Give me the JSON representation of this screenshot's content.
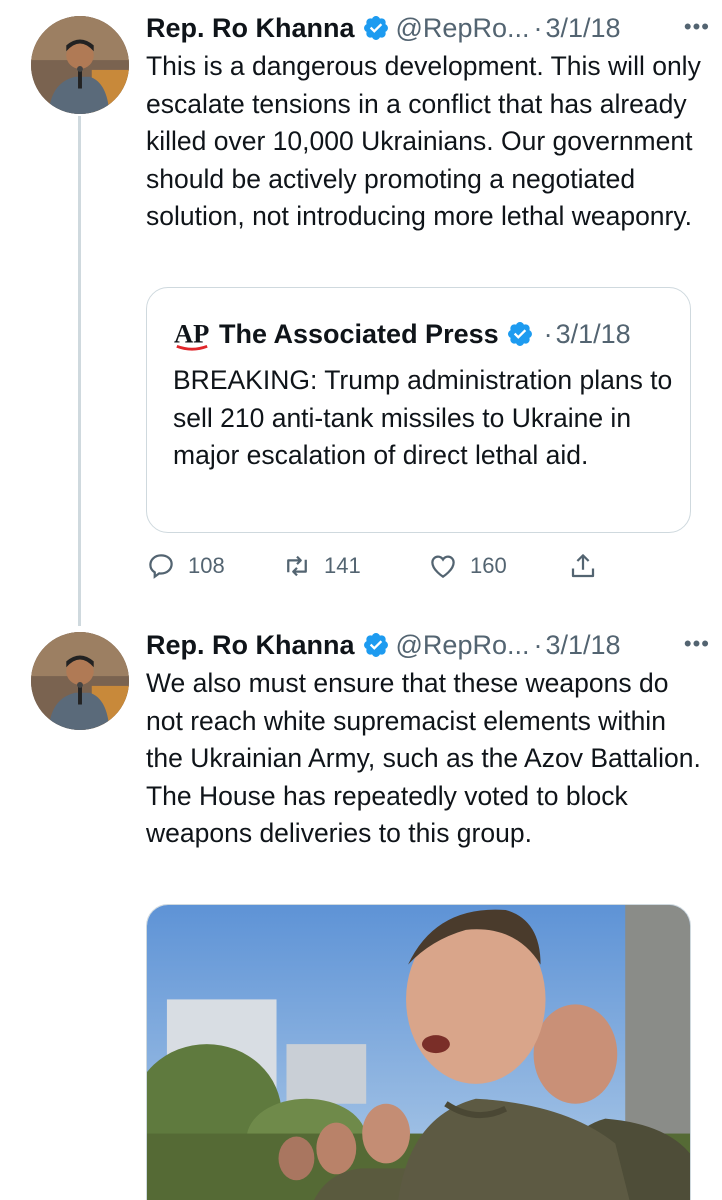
{
  "tweets": [
    {
      "name": "Rep. Ro Khanna",
      "handle": "@RepRo...",
      "dot": "·",
      "date": "3/1/18",
      "more": "•••",
      "text": "This is a dangerous development. This will only escalate tensions in a conflict that has already killed over 10,000 Ukrainians. Our government should be actively promoting a negotiated solution, not introducing more lethal weaponry.",
      "quote": {
        "logo_text": "AP",
        "name": "The Associated Press",
        "dot": "·",
        "date": "3/1/18",
        "text": "BREAKING: Trump administration plans to sell 210 anti-tank missiles to Ukraine in major escalation of direct lethal aid."
      },
      "actions": {
        "replies": "108",
        "retweets": "141",
        "likes": "160"
      }
    },
    {
      "name": "Rep. Ro Khanna",
      "handle": "@RepRo...",
      "dot": "·",
      "date": "3/1/18",
      "more": "•••",
      "text": "We also must ensure that these weapons do not reach white supremacist elements within the Ukrainian Army, such as the Azov Battalion. The House has repeatedly voted to block weapons deliveries to this group."
    }
  ],
  "colors": {
    "verified": "#1d9bf0",
    "secondary_text": "#536471",
    "border": "#cfd9de"
  }
}
